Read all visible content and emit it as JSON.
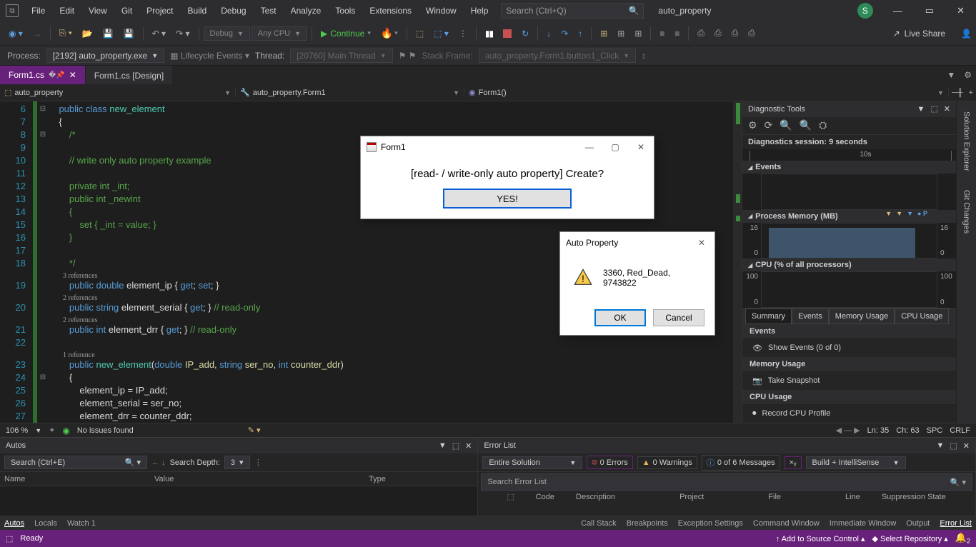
{
  "title_menu": [
    "File",
    "Edit",
    "View",
    "Git",
    "Project",
    "Build",
    "Debug",
    "Test",
    "Analyze",
    "Tools",
    "Extensions",
    "Window",
    "Help"
  ],
  "search_placeholder": "Search (Ctrl+Q)",
  "project_name": "auto_property",
  "user_initial": "S",
  "toolbar": {
    "config": "Debug",
    "platform": "Any CPU",
    "continue": "Continue",
    "liveshare": "Live Share"
  },
  "debugbar": {
    "process_label": "Process:",
    "process": "[2192] auto_property.exe",
    "lifecycle": "Lifecycle Events",
    "thread_label": "Thread:",
    "thread": "[20760] Main Thread",
    "stackframe_label": "Stack Frame:",
    "stackframe": "auto_property.Form1.button1_Click"
  },
  "tabs": {
    "active": "Form1.cs",
    "other": "Form1.cs [Design]"
  },
  "crumbs": {
    "ns": "auto_property",
    "cls": "auto_property.Form1",
    "member": "Form1()"
  },
  "code_lines": [
    {
      "n": "6",
      "fold": "⊟",
      "html": "    <span class='kw'>public</span> <span class='kw'>class</span> <span class='cls'>new_element</span>"
    },
    {
      "n": "7",
      "html": "    <span class='plain'>{</span>"
    },
    {
      "n": "8",
      "fold": "⊟",
      "html": "        <span class='cm'>/*</span>"
    },
    {
      "n": "9",
      "html": ""
    },
    {
      "n": "10",
      "html": "        <span class='cm'>// write only auto property example</span>"
    },
    {
      "n": "11",
      "html": ""
    },
    {
      "n": "12",
      "html": "        <span class='cm'>private int _int;</span>"
    },
    {
      "n": "13",
      "html": "        <span class='cm'>public int _newint</span>"
    },
    {
      "n": "14",
      "html": "        <span class='cm'>{</span>"
    },
    {
      "n": "15",
      "html": "            <span class='cm'>set { _int = value; }</span>"
    },
    {
      "n": "16",
      "html": "        <span class='cm'>}</span>"
    },
    {
      "n": "17",
      "html": ""
    },
    {
      "n": "18",
      "html": "        <span class='cm'>*/</span>"
    },
    {
      "ref": "3 references"
    },
    {
      "n": "19",
      "html": "        <span class='kw'>public</span> <span class='kw'>double</span> <span class='plain'>element_ip { </span><span class='kw'>get</span><span class='plain'>; </span><span class='kw'>set</span><span class='plain'>; }</span>"
    },
    {
      "ref": "2 references"
    },
    {
      "n": "20",
      "html": "        <span class='kw'>public</span> <span class='kw'>string</span> <span class='plain'>element_serial { </span><span class='kw'>get</span><span class='plain'>; }</span> <span class='cm'>// read-only</span>"
    },
    {
      "ref": "2 references"
    },
    {
      "n": "21",
      "html": "        <span class='kw'>public</span> <span class='kw'>int</span> <span class='plain'>element_drr { </span><span class='kw'>get</span><span class='plain'>; }</span> <span class='cm'>// read-only</span>"
    },
    {
      "n": "22",
      "html": ""
    },
    {
      "ref": "1 reference"
    },
    {
      "n": "23",
      "html": "        <span class='kw'>public</span> <span class='cls'>new_element</span><span class='plain'>(</span><span class='kw'>double</span> <span class='var'>IP_add</span><span class='plain'>, </span><span class='kw'>string</span> <span class='var'>ser_no</span><span class='plain'>, </span><span class='kw'>int</span> <span class='var'>counter_ddr</span><span class='plain'>)</span>"
    },
    {
      "n": "24",
      "fold": "⊟",
      "html": "        <span class='plain'>{</span>"
    },
    {
      "n": "25",
      "html": "            <span class='plain'>element_ip = IP_add;</span>"
    },
    {
      "n": "26",
      "html": "            <span class='plain'>element_serial = ser_no;</span>"
    },
    {
      "n": "27",
      "html": "            <span class='plain'>element_drr = counter_ddr;</span>"
    }
  ],
  "editor_status": {
    "zoom": "106 %",
    "issues": "No issues found",
    "ln": "Ln: 35",
    "ch": "Ch: 63",
    "ins": "SPC",
    "enc": "CRLF"
  },
  "diag": {
    "title": "Diagnostic Tools",
    "session": "Diagnostics session: 9 seconds",
    "time_tick": "10s",
    "sect_events": "Events",
    "sect_mem": "Process Memory (MB)",
    "mem_hi": "16",
    "mem_lo": "0",
    "marker_p": "P",
    "sect_cpu": "CPU (% of all processors)",
    "cpu_hi": "100",
    "cpu_lo": "0",
    "tabs": [
      "Summary",
      "Events",
      "Memory Usage",
      "CPU Usage"
    ],
    "events_head": "Events",
    "events_link": "Show Events (0 of 0)",
    "mem_head": "Memory Usage",
    "mem_link": "Take Snapshot",
    "cpu_head": "CPU Usage",
    "cpu_link": "Record CPU Profile"
  },
  "right_tabs": [
    "Solution Explorer",
    "Git Changes"
  ],
  "autos": {
    "title": "Autos",
    "search_placeholder": "Search (Ctrl+E)",
    "depth_label": "Search Depth:",
    "depth_value": "3",
    "cols": [
      "Name",
      "Value",
      "Type"
    ],
    "tabs": [
      "Autos",
      "Locals",
      "Watch 1"
    ]
  },
  "errlist": {
    "title": "Error List",
    "scope": "Entire Solution",
    "errors": "0 Errors",
    "warnings": "0 Warnings",
    "messages": "0 of 6 Messages",
    "filter": "Build + IntelliSense",
    "search_placeholder": "Search Error List",
    "cols": [
      "Code",
      "Description",
      "Project",
      "File",
      "Line",
      "Suppression State"
    ],
    "tabs": [
      "Call Stack",
      "Breakpoints",
      "Exception Settings",
      "Command Window",
      "Immediate Window",
      "Output",
      "Error List"
    ]
  },
  "status": {
    "ready": "Ready",
    "add_source": "Add to Source Control",
    "select_repo": "Select Repository",
    "bell_count": "2"
  },
  "dlg_form": {
    "title": "Form1",
    "text": "[read- / write-only auto property] Create?",
    "yes": "YES!"
  },
  "dlg_msg": {
    "title": "Auto Property",
    "text": "3360, Red_Dead, 9743822",
    "ok": "OK",
    "cancel": "Cancel"
  }
}
